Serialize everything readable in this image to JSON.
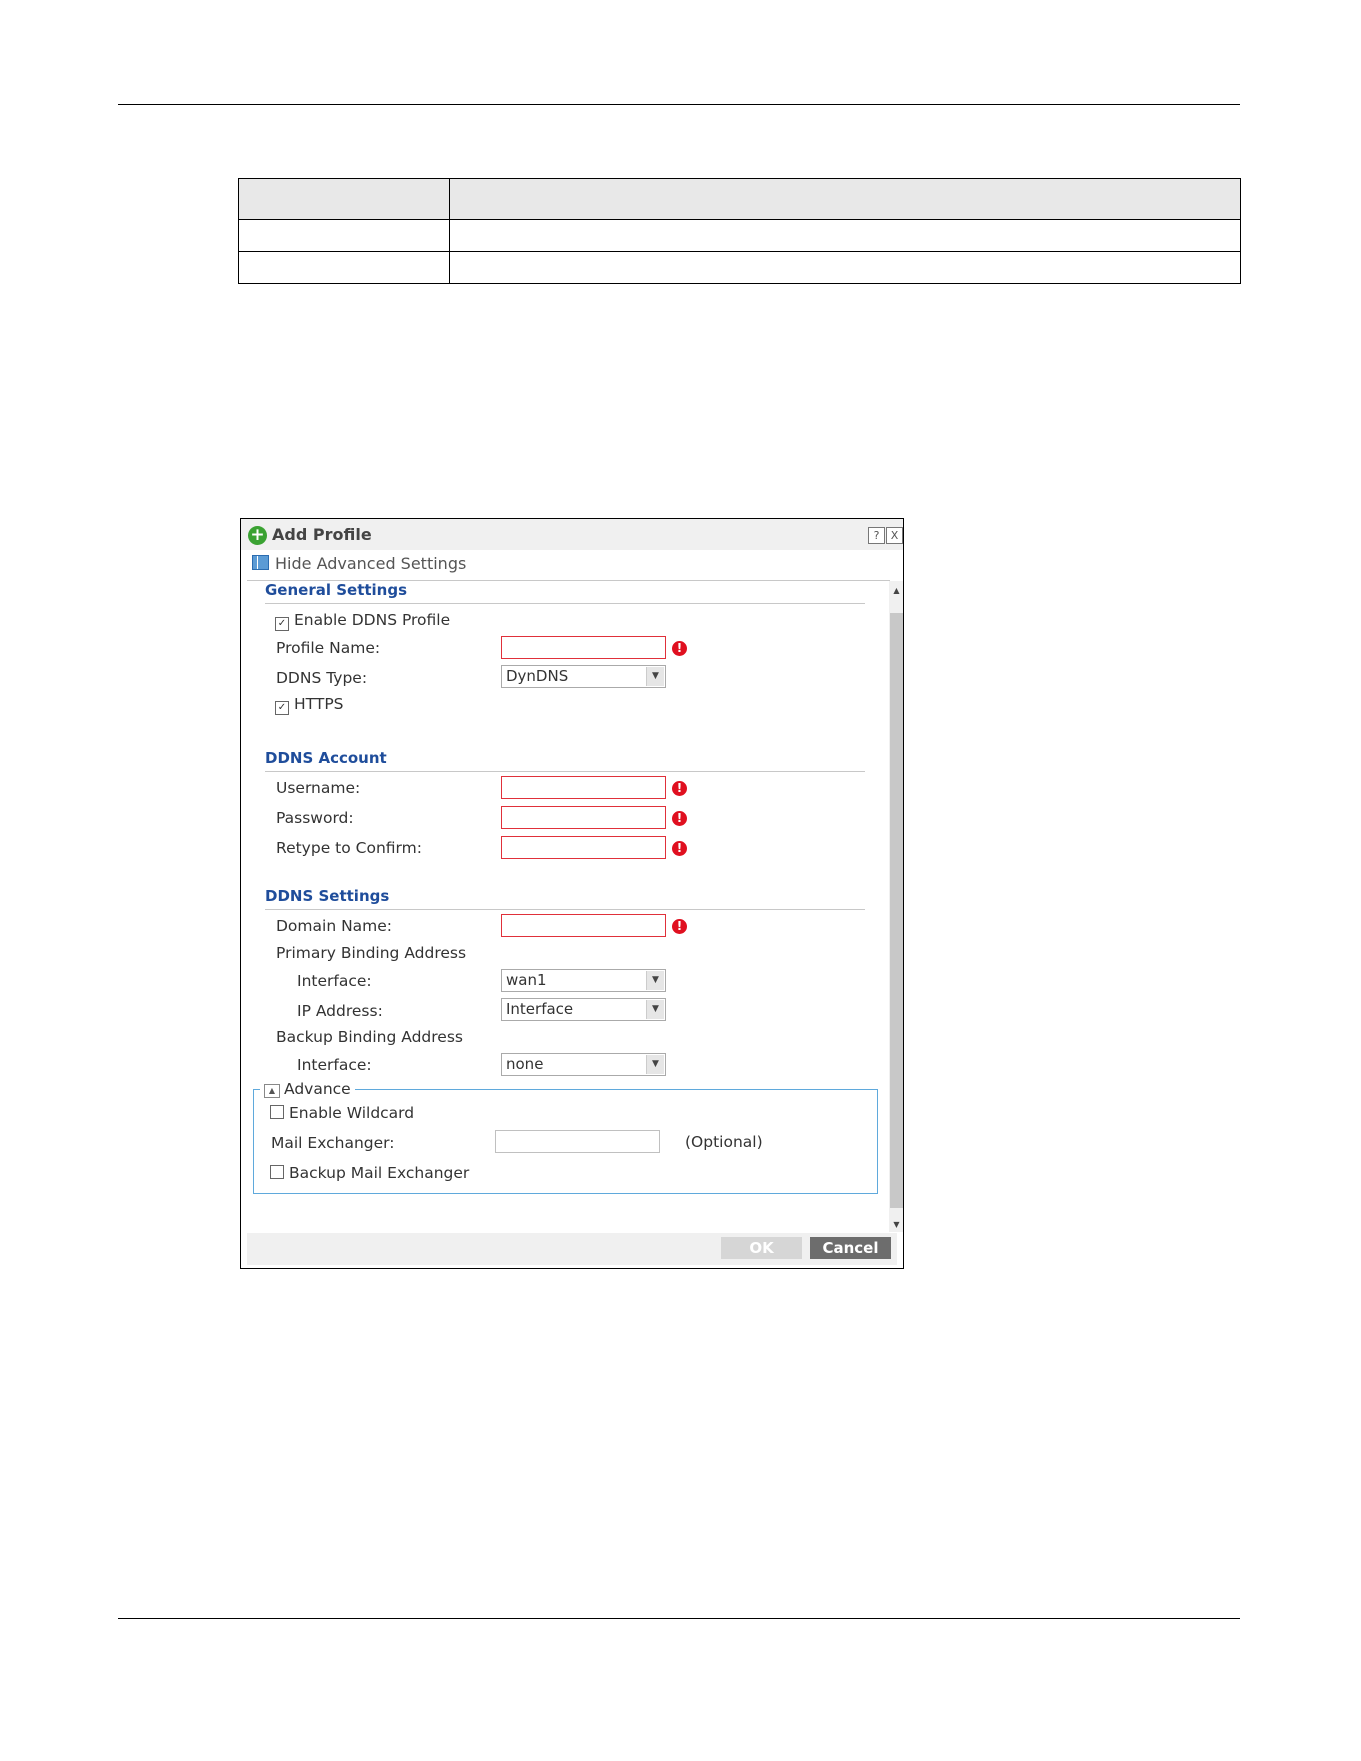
{
  "dialog": {
    "title": "Add Profile",
    "help_button": "?",
    "close_button": "X",
    "hide_advanced": "Hide Advanced Settings"
  },
  "general": {
    "title": "General Settings",
    "enable_ddns_profile": "Enable DDNS Profile",
    "profile_name_label": "Profile Name:",
    "ddns_type_label": "DDNS Type:",
    "ddns_type_value": "DynDNS",
    "https_label": "HTTPS"
  },
  "account": {
    "title": "DDNS Account",
    "username_label": "Username:",
    "password_label": "Password:",
    "retype_label": "Retype to Confirm:"
  },
  "settings": {
    "title": "DDNS Settings",
    "domain_label": "Domain Name:",
    "primary_label": "Primary Binding Address",
    "primary_interface_label": "Interface:",
    "primary_interface_value": "wan1",
    "ip_address_label": "IP Address:",
    "ip_address_value": "Interface",
    "backup_label": "Backup Binding Address",
    "backup_interface_label": "Interface:",
    "backup_interface_value": "none"
  },
  "advance": {
    "title": "Advance",
    "enable_wildcard": "Enable Wildcard",
    "mail_exchanger_label": "Mail Exchanger:",
    "optional_hint": "(Optional)",
    "backup_mail_exchanger": "Backup Mail Exchanger"
  },
  "footer": {
    "ok": "OK",
    "cancel": "Cancel"
  },
  "colors": {
    "section_title": "#1f4d9b",
    "required_border": "#e0303a",
    "advance_border": "#5fa9dc"
  }
}
